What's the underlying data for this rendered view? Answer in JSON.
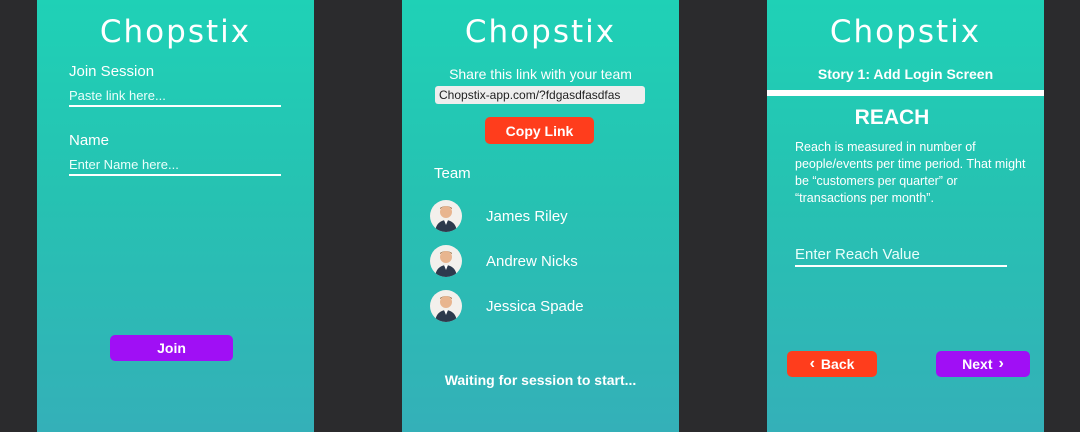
{
  "app_name": "Chopstix",
  "join_screen": {
    "join_label": "Join Session",
    "link_placeholder": "Paste link here...",
    "name_label": "Name",
    "name_placeholder": "Enter Name here...",
    "join_button": "Join"
  },
  "share_screen": {
    "share_label": "Share this link with your team",
    "share_link": "Chopstix-app.com/?fdgasdfasdfas",
    "copy_button": "Copy Link",
    "team_label": "Team",
    "team": [
      {
        "name": "James Riley"
      },
      {
        "name": "Andrew Nicks"
      },
      {
        "name": "Jessica Spade"
      }
    ],
    "waiting_text": "Waiting for session to start..."
  },
  "story_screen": {
    "story_title": "Story 1: Add Login Screen",
    "metric_title": "REACH",
    "metric_description": "Reach is measured in number of people/events per time period. That might be “customers per quarter” or “transactions per month”.",
    "value_placeholder": "Enter Reach Value",
    "back_button": "Back",
    "next_button": "Next"
  },
  "colors": {
    "gradient_top": "#1fd1b6",
    "gradient_bottom": "#34b0b8",
    "primary_button": "#a00ff5",
    "secondary_button": "#ff3d1c",
    "background": "#2b2b2d"
  },
  "icons": [
    "avatar-icon",
    "chevron-left-icon",
    "chevron-right-icon"
  ]
}
